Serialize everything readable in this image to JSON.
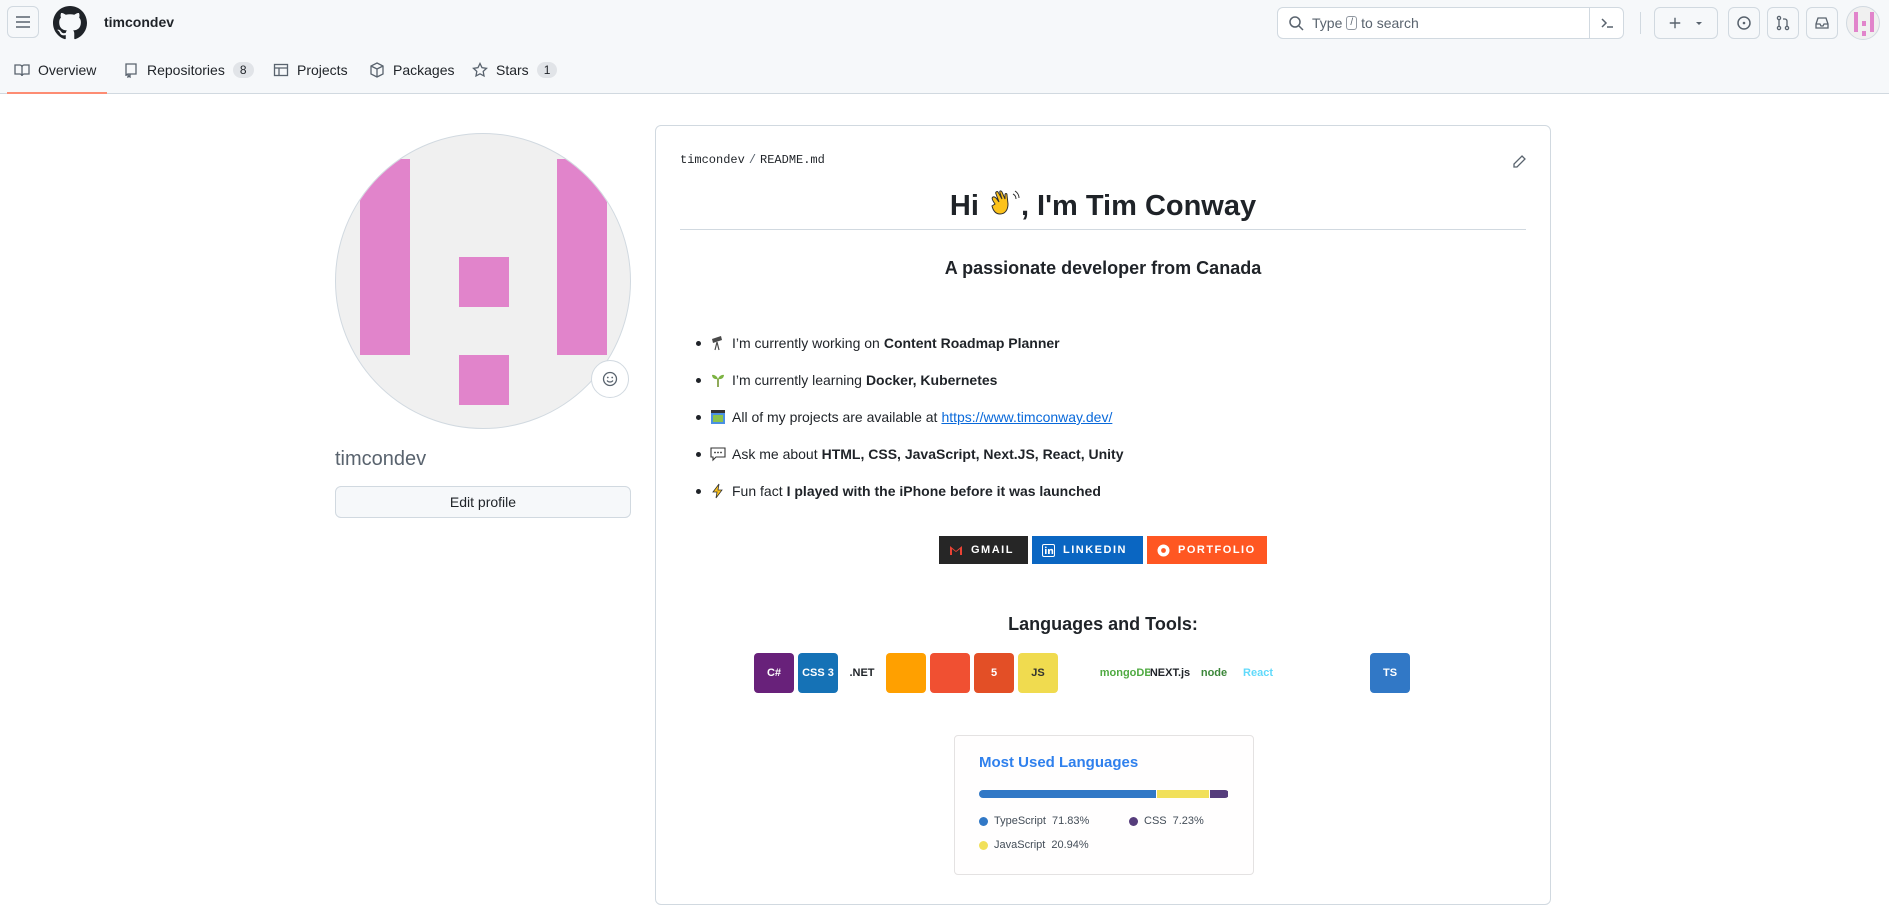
{
  "header": {
    "username": "timcondev",
    "search_prefix": "Type",
    "search_key": "/",
    "search_suffix": "to search"
  },
  "tabs": [
    {
      "label": "Overview",
      "count": ""
    },
    {
      "label": "Repositories",
      "count": "8"
    },
    {
      "label": "Projects",
      "count": ""
    },
    {
      "label": "Packages",
      "count": ""
    },
    {
      "label": "Stars",
      "count": "1"
    }
  ],
  "profile": {
    "name": "timcondev",
    "edit_label": "Edit profile",
    "avatar_color": "#e184cb"
  },
  "readme": {
    "owner": "timcondev",
    "file": "README.md",
    "heading_pre": "Hi",
    "heading_post": ", I'm Tim Conway",
    "subheading": "A passionate developer from Canada",
    "bullets": [
      {
        "icon": "telescope-icon",
        "text": "I’m currently working on",
        "strong": "Content Roadmap Planner"
      },
      {
        "icon": "seedling-icon",
        "text": "I’m currently learning",
        "strong": "Docker, Kubernetes"
      },
      {
        "icon": "window-icon",
        "text": "All of my projects are available at",
        "link": "https://www.timconway.dev/"
      },
      {
        "icon": "speech-bubble-icon",
        "text": "Ask me about",
        "strong": "HTML, CSS, JavaScript, Next.JS, React, Unity"
      },
      {
        "icon": "lightning-icon",
        "text": "Fun fact",
        "strong": "I played with the iPhone before it was launched"
      }
    ],
    "badges": {
      "gmail": "GMAIL",
      "linkedin": "LINKEDIN",
      "portfolio": "PORTFOLIO"
    },
    "tools_title": "Languages and Tools:",
    "tools": [
      {
        "name": "csharp",
        "label": "C#",
        "bg": "#68217a",
        "fg": "#ffffff"
      },
      {
        "name": "css3",
        "label": "CSS 3",
        "bg": "#1572b6",
        "fg": "#ffffff"
      },
      {
        "name": "dotnet",
        "label": ".NET",
        "bg": "#ffffff",
        "fg": "#1f2328"
      },
      {
        "name": "firebase",
        "label": "",
        "bg": "#ffa000",
        "fg": "#ffffff"
      },
      {
        "name": "git",
        "label": "",
        "bg": "#f05032",
        "fg": "#ffffff"
      },
      {
        "name": "html5",
        "label": "5",
        "bg": "#e34f26",
        "fg": "#ffffff"
      },
      {
        "name": "javascript",
        "label": "JS",
        "bg": "#f0db4f",
        "fg": "#323330"
      },
      {
        "name": "linux",
        "label": "",
        "bg": "#ffffff",
        "fg": "#1f2328"
      },
      {
        "name": "mongodb",
        "label": "mongoDB",
        "bg": "#ffffff",
        "fg": "#4faa41"
      },
      {
        "name": "nextjs",
        "label": "NEXT.js",
        "bg": "#ffffff",
        "fg": "#1f2328"
      },
      {
        "name": "nodejs",
        "label": "node",
        "bg": "#ffffff",
        "fg": "#3c873a"
      },
      {
        "name": "react-native",
        "label": "React",
        "bg": "#ffffff",
        "fg": "#61dafb"
      },
      {
        "name": "react",
        "label": "",
        "bg": "#ffffff",
        "fg": "#61dafb"
      },
      {
        "name": "tailwind",
        "label": "",
        "bg": "#ffffff",
        "fg": "#38bdf8"
      },
      {
        "name": "typescript",
        "label": "TS",
        "bg": "#3178c6",
        "fg": "#ffffff"
      },
      {
        "name": "unity",
        "label": "",
        "bg": "#ffffff",
        "fg": "#1f2328"
      }
    ],
    "languages": {
      "title": "Most Used Languages",
      "items": [
        {
          "name": "TypeScript",
          "percent": "71.83%",
          "value": 71.83,
          "color": "#3178c6"
        },
        {
          "name": "JavaScript",
          "percent": "20.94%",
          "value": 20.94,
          "color": "#f1e05a"
        },
        {
          "name": "CSS",
          "percent": "7.23%",
          "value": 7.23,
          "color": "#563d7c"
        }
      ]
    }
  }
}
